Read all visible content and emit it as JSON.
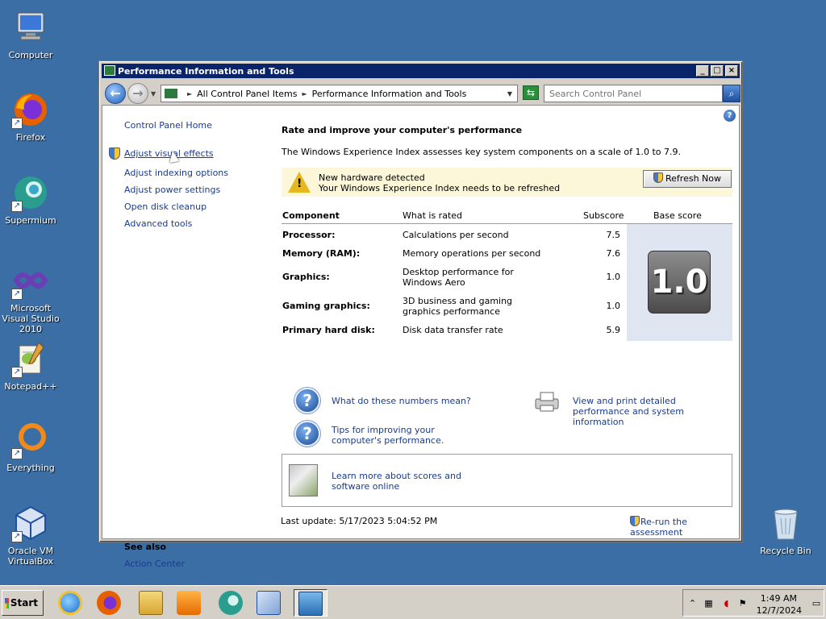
{
  "desktop": {
    "icons": [
      {
        "label": "Computer",
        "icon": "computer-icon"
      },
      {
        "label": "Firefox",
        "icon": "firefox-icon"
      },
      {
        "label": "Supermium",
        "icon": "supermium-icon"
      },
      {
        "label": "Microsoft Visual Studio 2010",
        "icon": "visual-studio-icon"
      },
      {
        "label": "Notepad++",
        "icon": "notepadpp-icon"
      },
      {
        "label": "Everything",
        "icon": "everything-icon"
      },
      {
        "label": "Oracle VM VirtualBox",
        "icon": "virtualbox-icon"
      },
      {
        "label": "Recycle Bin",
        "icon": "recycle-bin-icon"
      }
    ],
    "background_color": "#3a6ea5"
  },
  "window": {
    "title": "Performance Information and Tools",
    "buttons": {
      "minimize": "_",
      "maximize": "□",
      "close": "×"
    },
    "address": {
      "items": [
        "All Control Panel Items",
        "Performance Information and Tools"
      ],
      "separator": "►"
    },
    "search": {
      "placeholder": "Search Control Panel"
    },
    "help": "?"
  },
  "left_pane": {
    "home": "Control Panel Home",
    "links": [
      "Adjust visual effects",
      "Adjust indexing options",
      "Adjust power settings",
      "Open disk cleanup",
      "Advanced tools"
    ],
    "see_also_title": "See also",
    "see_also_links": [
      "Action Center"
    ]
  },
  "main": {
    "heading": "Rate and improve your computer's performance",
    "description": "The Windows Experience Index assesses key system components on a scale of 1.0 to 7.9.",
    "alert": {
      "line1": "New hardware detected",
      "line2": "Your Windows Experience Index needs to be refreshed",
      "button": "Refresh Now"
    },
    "table": {
      "headers": [
        "Component",
        "What is rated",
        "Subscore",
        "Base score"
      ],
      "rows": [
        {
          "component": "Processor:",
          "rated": "Calculations per second",
          "subscore": "7.5"
        },
        {
          "component": "Memory (RAM):",
          "rated": "Memory operations per second",
          "subscore": "7.6"
        },
        {
          "component": "Graphics:",
          "rated": "Desktop performance for Windows Aero",
          "subscore": "1.0"
        },
        {
          "component": "Gaming graphics:",
          "rated": "3D business and gaming graphics performance",
          "subscore": "1.0"
        },
        {
          "component": "Primary hard disk:",
          "rated": "Disk data transfer rate",
          "subscore": "5.9"
        }
      ],
      "base_score": "1.0"
    },
    "help_links": {
      "what_mean": "What do these numbers mean?",
      "tips": "Tips for improving your computer's performance.",
      "print": "View and print detailed performance and system information"
    },
    "learn_more": "Learn more about scores and software online",
    "last_update": "Last update: 5/17/2023 5:04:52 PM",
    "rerun": "Re-run the assessment"
  },
  "taskbar": {
    "start": "Start",
    "apps": [
      "internet-explorer-icon",
      "firefox-icon",
      "file-explorer-icon",
      "media-player-icon",
      "supermium-icon",
      "virtualbox-icon",
      "performance-info-icon"
    ],
    "clock": {
      "time": "1:49 AM",
      "date": "12/7/2024"
    }
  }
}
